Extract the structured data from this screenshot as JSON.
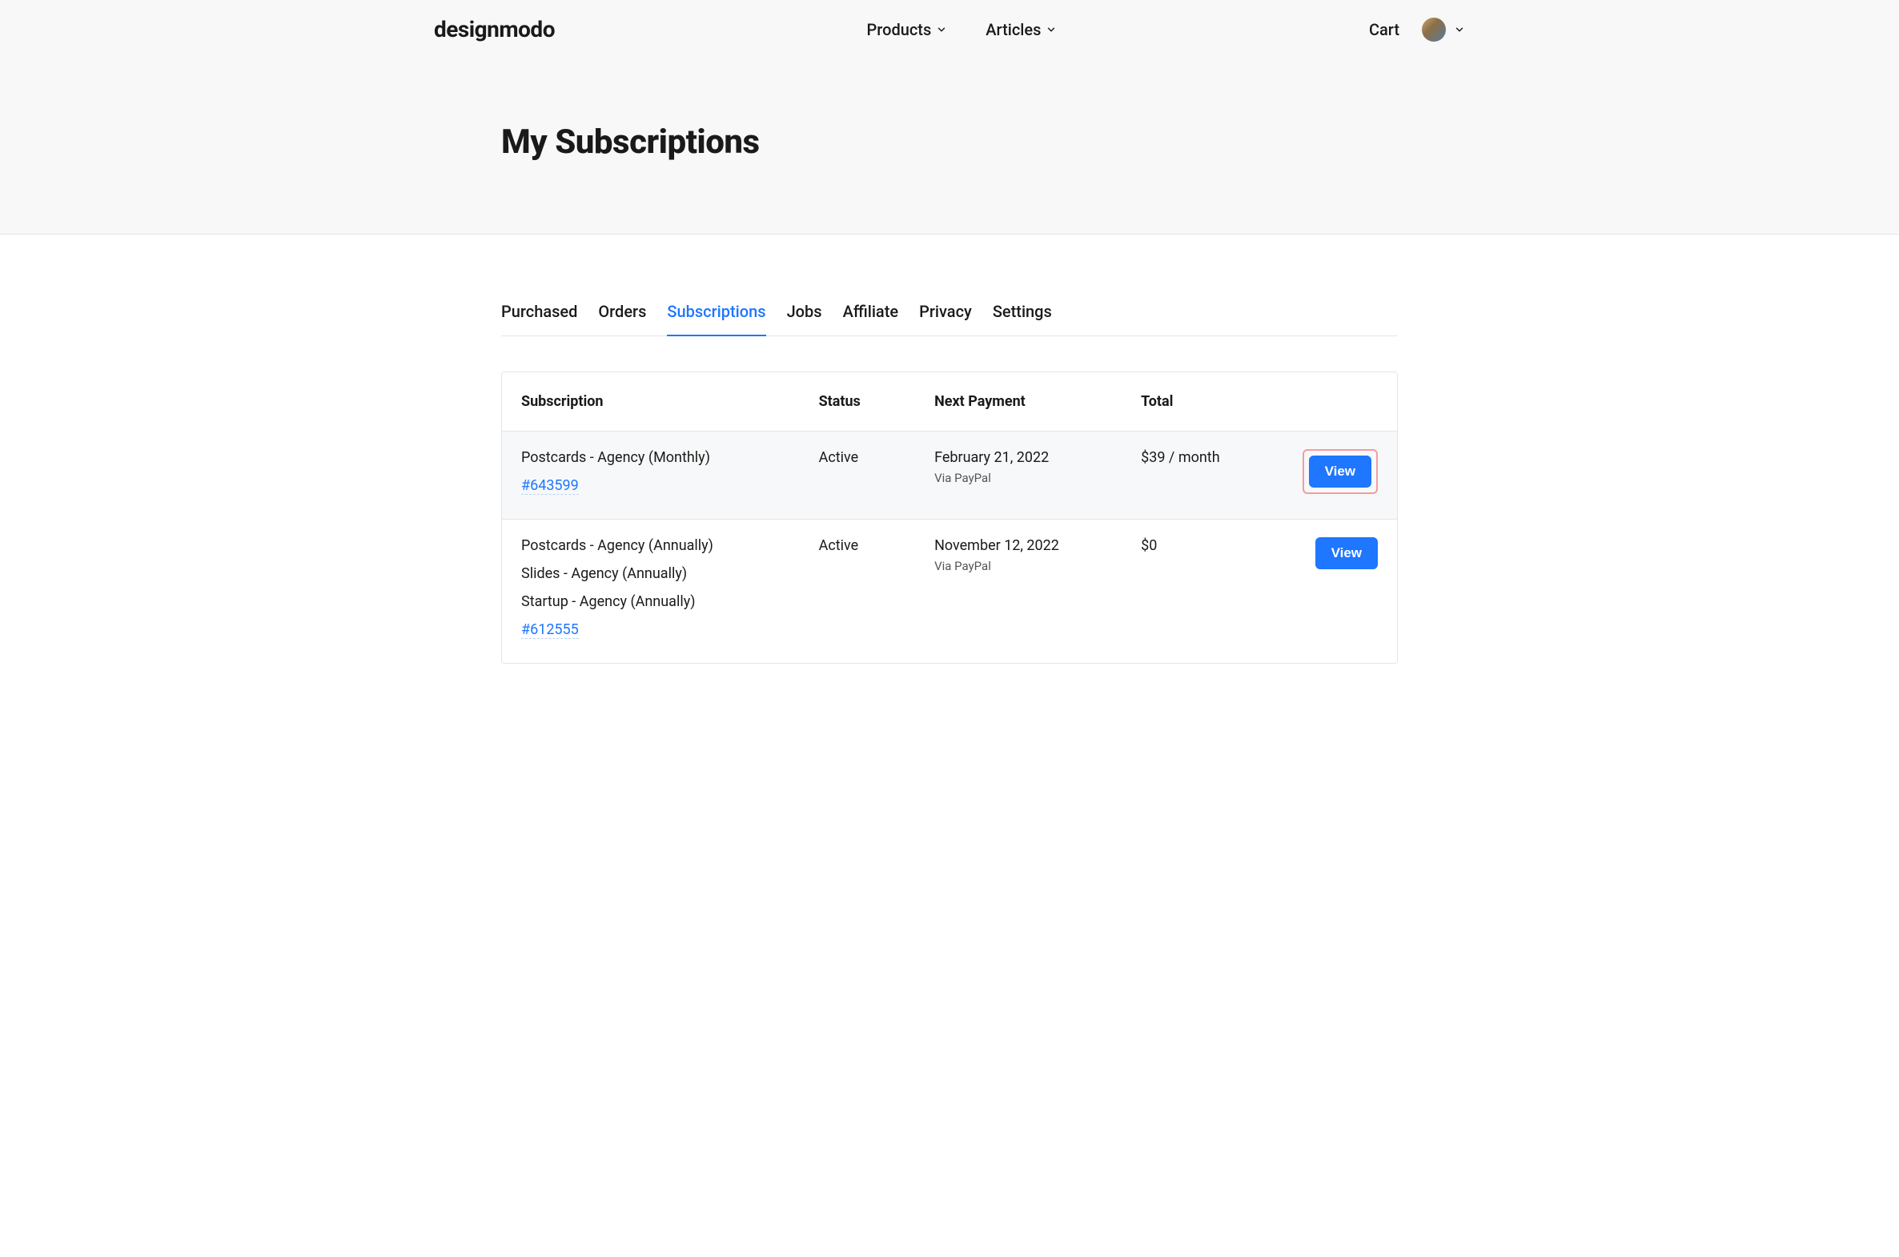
{
  "header": {
    "logo": "designmodo",
    "nav": {
      "products": "Products",
      "articles": "Articles"
    },
    "cart": "Cart"
  },
  "page_title": "My Subscriptions",
  "tabs": [
    {
      "label": "Purchased",
      "active": false
    },
    {
      "label": "Orders",
      "active": false
    },
    {
      "label": "Subscriptions",
      "active": true
    },
    {
      "label": "Jobs",
      "active": false
    },
    {
      "label": "Affiliate",
      "active": false
    },
    {
      "label": "Privacy",
      "active": false
    },
    {
      "label": "Settings",
      "active": false
    }
  ],
  "table": {
    "headers": {
      "subscription": "Subscription",
      "status": "Status",
      "next_payment": "Next Payment",
      "total": "Total"
    },
    "rows": [
      {
        "names": [
          "Postcards - Agency (Monthly)"
        ],
        "id": "#643599",
        "status": "Active",
        "next_payment": "February 21, 2022",
        "payment_via": "Via PayPal",
        "total": "$39 / month",
        "action_label": "View",
        "highlight": true,
        "outline_button": true
      },
      {
        "names": [
          "Postcards - Agency (Annually)",
          "Slides - Agency (Annually)",
          "Startup - Agency (Annually)"
        ],
        "id": "#612555",
        "status": "Active",
        "next_payment": "November 12, 2022",
        "payment_via": "Via PayPal",
        "total": "$0",
        "action_label": "View",
        "highlight": false,
        "outline_button": false
      }
    ]
  }
}
